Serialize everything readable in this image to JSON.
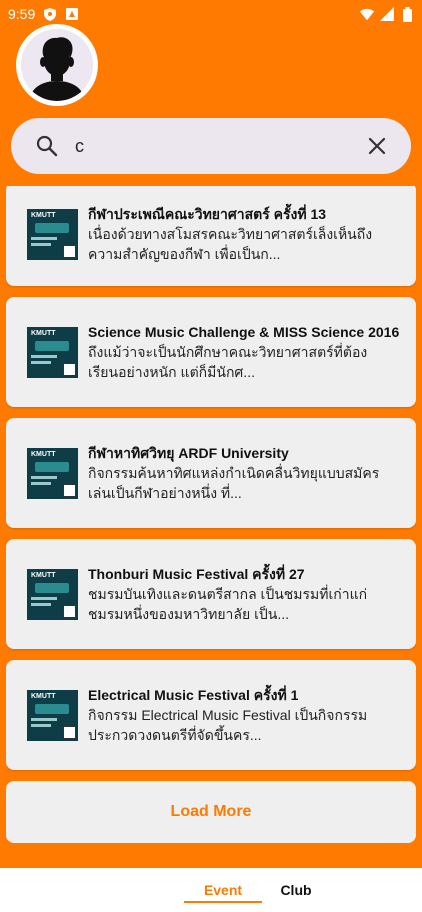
{
  "status_bar": {
    "time": "9:59"
  },
  "search": {
    "value": "c",
    "placeholder": ""
  },
  "events": [
    {
      "title": "กีฬาประเพณีคณะวิทยาศาสตร์ ครั้งที่ 13",
      "description": "เนื่องด้วยทางสโมสรคณะวิทยาศาสตร์เล็งเห็นถึงความสำคัญของกีฬา เพื่อเป็นก..."
    },
    {
      "title": "Science Music Challenge & MISS Science 2016",
      "description": "ถึงแม้ว่าจะเป็นนักศึกษาคณะวิทยาศาสตร์ที่ต้องเรียนอย่างหนัก แต่ก็มีนักศ..."
    },
    {
      "title": "กีฬาหาทิศวิทยุ ARDF University",
      "description": "กิจกรรมค้นหาทิศแหล่งกำเนิดคลื่นวิทยุแบบสมัครเล่นเป็นกีฬาอย่างหนึ่ง ที่..."
    },
    {
      "title": "Thonburi Music Festival ครั้งที่ 27",
      "description": "ชมรมบันเทิงและดนตรีสากล เป็นชมรมที่เก่าแก่ชมรมหนึ่งของมหาวิทยาลัย เป็น..."
    },
    {
      "title": "Electrical Music Festival ครั้งที่ 1",
      "description": "กิจกรรม Electrical Music Festival เป็นกิจกรรมประกวดวงดนตรีที่จัดขึ้นคร..."
    }
  ],
  "thumb_label": "KMUTT",
  "load_more_label": "Load More",
  "tabs": [
    {
      "label": "Event",
      "active": true
    },
    {
      "label": "Club",
      "active": false
    }
  ],
  "colors": {
    "accent": "#FF7A00",
    "card_bg": "#EFEFEF",
    "search_bg": "#ECE6EF"
  },
  "icons": {
    "search": "search-icon",
    "clear": "close-icon",
    "avatar": "person-avatar-icon"
  }
}
